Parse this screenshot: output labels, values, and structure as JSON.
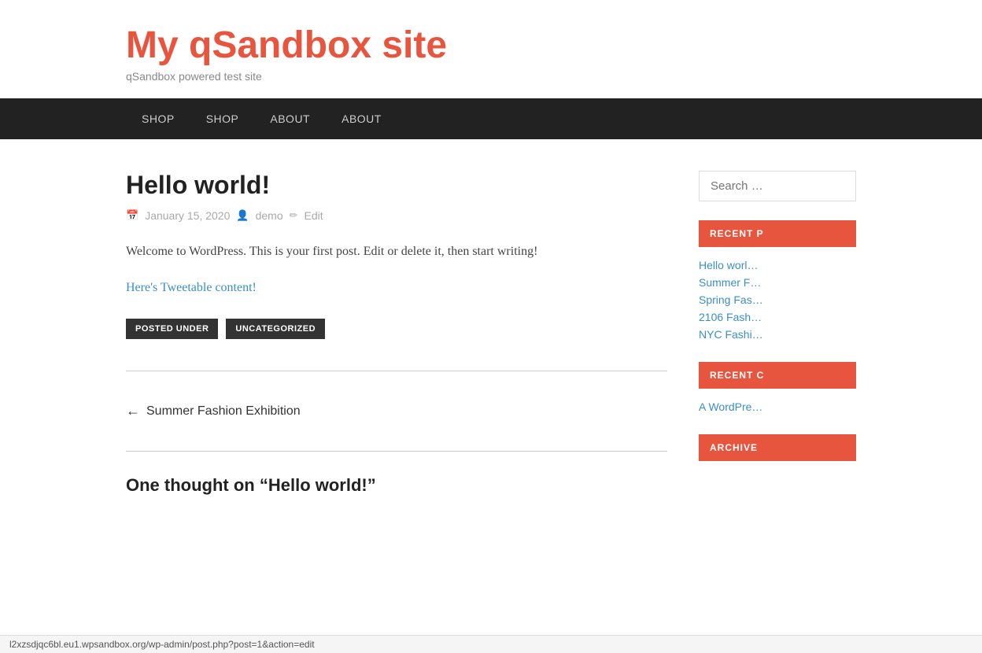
{
  "site": {
    "title": "My qSandbox site",
    "tagline": "qSandbox powered test site"
  },
  "nav": {
    "items": [
      {
        "label": "SHOP"
      },
      {
        "label": "SHOP"
      },
      {
        "label": "ABOUT"
      },
      {
        "label": "ABOUT"
      }
    ]
  },
  "post": {
    "title": "Hello world!",
    "date": "January 15, 2020",
    "author": "demo",
    "edit_label": "Edit",
    "body": "Welcome to WordPress. This is your first post. Edit or delete it, then start writing!",
    "tweetable_link": "Here's Tweetable content!",
    "tags": {
      "label": "POSTED UNDER",
      "value": "UNCATEGORIZED"
    }
  },
  "navigation": {
    "prev_label": "Summer Fashion Exhibition"
  },
  "comments": {
    "title": "One thought on “Hello world!”"
  },
  "sidebar": {
    "search_placeholder": "Search …",
    "recent_posts_title": "RECENT P",
    "recent_posts": [
      {
        "label": "Hello worl…"
      },
      {
        "label": "Summer F…"
      },
      {
        "label": "Spring Fas…"
      },
      {
        "label": "2106 Fash…"
      },
      {
        "label": "NYC Fashi…"
      }
    ],
    "recent_comments_title": "RECENT C",
    "recent_comments": [
      {
        "label": "A WordPre…"
      }
    ],
    "archives_title": "ARCHIVE"
  },
  "status_bar": {
    "url": "l2xzsdjqc6bl.eu1.wpsandbox.org/wp-admin/post.php?post=1&action=edit"
  }
}
